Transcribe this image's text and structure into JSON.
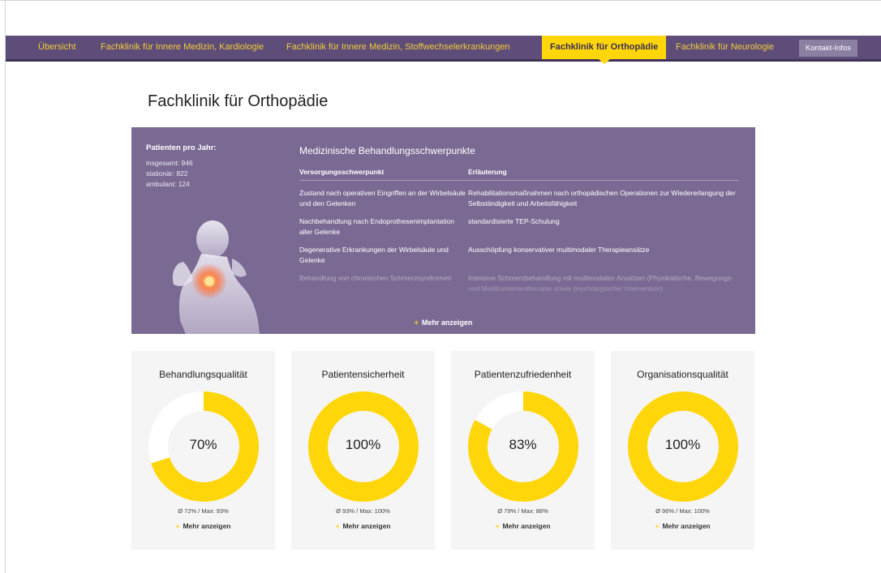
{
  "nav": {
    "items": [
      {
        "label": "Übersicht",
        "active": false
      },
      {
        "label": "Fachklinik für Innere Medizin, Kardiologie",
        "active": false
      },
      {
        "label": "Fachklinik für Innere Medizin, Stoffwechselerkrankungen",
        "active": false
      },
      {
        "label": "Fachklinik für Orthopädie",
        "active": true
      },
      {
        "label": "Fachklinik für Neurologie",
        "active": false
      }
    ],
    "contact_label": "Kontakt-Infos"
  },
  "page_title": "Fachklinik für Orthopädie",
  "panel": {
    "stats_title": "Patienten pro Jahr:",
    "stats": [
      "insgesamt: 946",
      "stationär: 822",
      "ambulant: 124"
    ],
    "heading": "Medizinische Behandlungsschwerpunkte",
    "columns": [
      "Versorgungsschwerpunkt",
      "Erläuterung"
    ],
    "rows": [
      [
        "Zustand nach operativen Eingriffen an der Wirbelsäule und den Gelenken",
        "Rehabilitationsmaßnahmen nach orthopädischen Operationen zur Wiedererlangung der Selbständigkeit und Arbeitsfähigkeit"
      ],
      [
        "Nachbehandlung nach Endoprothesenimplantation aller Gelenke",
        "standardisierte TEP-Schulung"
      ],
      [
        "Degenerative Erkrankungen der Wirbelsäule und Gelenke",
        "Ausschöpfung konservativer multimodaler Therapieansätze"
      ],
      [
        "Behandlung von chronischen Schmerzsyndromen",
        "Intensive Schmerzbehandlung mit multimodalen Ansätzen (Physikalische, Bewegungs- und Medikamententherapie sowie psychologischer Intervention)"
      ]
    ],
    "more_label": "Mehr anzeigen"
  },
  "cards": [
    {
      "title": "Behandlungsqualität",
      "value": 70,
      "value_label": "70%",
      "stats": "Ø 72% / Max: 93%",
      "more_label": "Mehr anzeigen"
    },
    {
      "title": "Patientensicherheit",
      "value": 100,
      "value_label": "100%",
      "stats": "Ø 93% / Max: 100%",
      "more_label": "Mehr anzeigen"
    },
    {
      "title": "Patientenzufriedenheit",
      "value": 83,
      "value_label": "83%",
      "stats": "Ø 79% / Max: 88%",
      "more_label": "Mehr anzeigen"
    },
    {
      "title": "Organisationsqualität",
      "value": 100,
      "value_label": "100%",
      "stats": "Ø 96% / Max: 100%",
      "more_label": "Mehr anzeigen"
    }
  ],
  "colors": {
    "nav_bg": "#5e4d78",
    "nav_text": "#f2cb3a",
    "accent": "#ffd60a",
    "panel_bg": "#7a6a93",
    "card_bg": "#f5f5f5",
    "donut_track": "#ffffff"
  },
  "icons": {
    "plus": "plus-icon",
    "figure": "neck-pain-figure"
  }
}
